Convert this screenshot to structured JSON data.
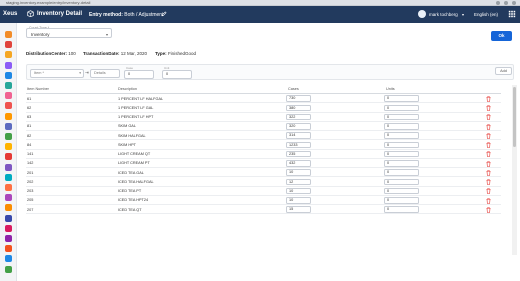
{
  "browser": {
    "url": "staging.inventory.example/entry/inventory-detail"
  },
  "header": {
    "logo": "Xeus",
    "title": "Inventory Detail",
    "entry_method_label": "Entry method:",
    "entry_method_value": "Both / Adjustment",
    "user": "mark tochberg",
    "language": "English (en)",
    "bg_color": "#223a5e"
  },
  "form": {
    "count_type_label": "Count Type *",
    "count_type_value": "Inventory",
    "ok_label": "Ok"
  },
  "info": {
    "distribution_center_label": "DistributionCenter:",
    "distribution_center_value": "100",
    "transaction_date_label": "TransactionDate:",
    "transaction_date_value": "12 Mar, 2020",
    "type_label": "Type:",
    "type_value": "FinishedGood"
  },
  "filter": {
    "item_placeholder": "Item *",
    "details_placeholder": "Details",
    "case_label": "Case",
    "case_value": "0",
    "unit_label": "Unit",
    "unit_value": "0",
    "add_label": "Add"
  },
  "table": {
    "headers": {
      "item": "Item Number",
      "description": "Description",
      "cases": "Cases",
      "units": "Units"
    },
    "rows": [
      {
        "item": "61",
        "description": "1 PERCENT LF HALFGAL",
        "cases": "730",
        "units": "0"
      },
      {
        "item": "62",
        "description": "1 PERCENT LF GAL",
        "cases": "380",
        "units": "0"
      },
      {
        "item": "63",
        "description": "1 PERCENT LF HPT",
        "cases": "322",
        "units": "0"
      },
      {
        "item": "81",
        "description": "SKIM GAL",
        "cases": "320",
        "units": "0"
      },
      {
        "item": "82",
        "description": "SKIM HALFGAL",
        "cases": "314",
        "units": "0"
      },
      {
        "item": "84",
        "description": "SKIM HPT",
        "cases": "1233",
        "units": "0"
      },
      {
        "item": "141",
        "description": "LIGHT CREAM QT",
        "cases": "235",
        "units": "0"
      },
      {
        "item": "142",
        "description": "LIGHT CREAM PT",
        "cases": "432",
        "units": "0"
      },
      {
        "item": "201",
        "description": "ICED TEA GAL",
        "cases": "10",
        "units": "0"
      },
      {
        "item": "202",
        "description": "ICED TEA HALFGAL",
        "cases": "12",
        "units": "0"
      },
      {
        "item": "203",
        "description": "ICED TEA PT",
        "cases": "10",
        "units": "0"
      },
      {
        "item": "205",
        "description": "ICED TEA HPT24",
        "cases": "10",
        "units": "0"
      },
      {
        "item": "207",
        "description": "ICED TEA QT",
        "cases": "15",
        "units": "0"
      }
    ]
  },
  "sidebar": {
    "icon_colors": [
      "#f28c28",
      "#e0443c",
      "#f5a623",
      "#8b5cf6",
      "#1e88e5",
      "#26a69a",
      "#f06292",
      "#ef5350",
      "#ff9800",
      "#5c6bc0",
      "#43a047",
      "#ffb300",
      "#e53935",
      "#7e57c2",
      "#00acc1",
      "#ff7043",
      "#ab47bc",
      "#fb8c00",
      "#3949ab",
      "#d81b60",
      "#8e24aa",
      "#f4511e",
      "#1e88e5",
      "#43a047"
    ]
  }
}
